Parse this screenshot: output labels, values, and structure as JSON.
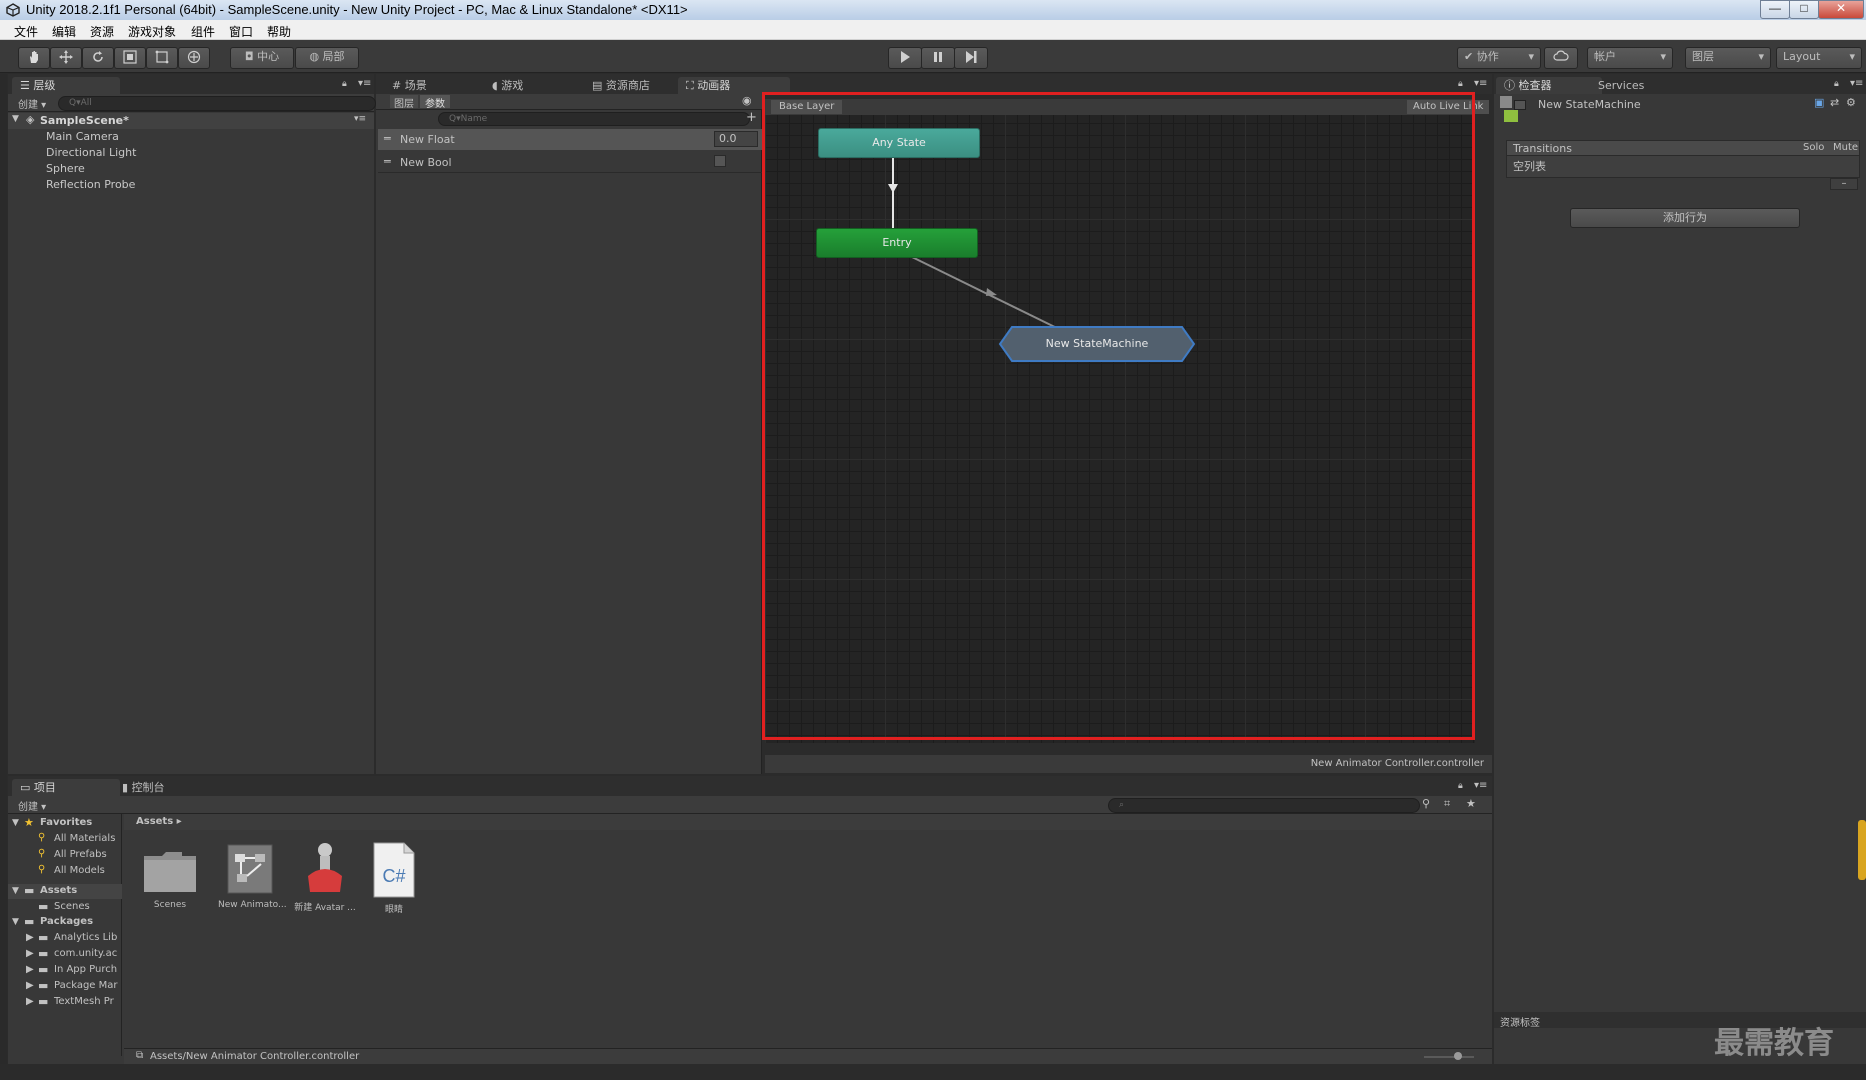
{
  "window": {
    "title": "Unity 2018.2.1f1 Personal (64bit) - SampleScene.unity - New Unity Project - PC, Mac & Linux Standalone* <DX11>",
    "min": "—",
    "max": "□",
    "close": "✕"
  },
  "menu": [
    "文件",
    "编辑",
    "资源",
    "游戏对象",
    "组件",
    "窗口",
    "帮助"
  ],
  "toolbar": {
    "pivot": "中心",
    "space": "局部",
    "collab": "协作",
    "account": "帐户",
    "layers": "图层",
    "layout": "Layout"
  },
  "hierarchy": {
    "tab": "层级",
    "create": "创建",
    "search_placeholder": "Q▾All",
    "scene": "SampleScene*",
    "items": [
      "Main Camera",
      "Directional Light",
      "Sphere",
      "Reflection Probe"
    ]
  },
  "center_tabs": [
    "场景",
    "游戏",
    "资源商店",
    "动画器"
  ],
  "animator": {
    "layers_tab": "图层",
    "params_tab": "参数",
    "search_placeholder": "Q▾Name",
    "params": [
      {
        "name": "New Float",
        "value": "0.0"
      },
      {
        "name": "New Bool",
        "value": ""
      }
    ],
    "breadcrumb": "Base Layer",
    "auto_live": "Auto Live Link",
    "nodes": {
      "any_state": "Any State",
      "entry": "Entry",
      "state_machine": "New StateMachine"
    },
    "footer": "New Animator Controller.controller",
    "colors": {
      "highlight": "#e02020",
      "entry": "#1d8a2e",
      "any_state": "#3b9b8c"
    }
  },
  "inspector": {
    "tab": "检查器",
    "services_tab": "Services",
    "object": "New StateMachine",
    "transitions": "Transitions",
    "solo": "Solo",
    "mute": "Mute",
    "empty_list": "空列表",
    "add_behaviour": "添加行为",
    "asset_labels": "资源标签"
  },
  "project": {
    "tab": "项目",
    "console_tab": "控制台",
    "create": "创建",
    "favorites_label": "Favorites",
    "favorites": [
      "All Materials",
      "All Prefabs",
      "All Models"
    ],
    "assets_label": "Assets",
    "assets_children": [
      "Scenes"
    ],
    "packages_label": "Packages",
    "packages": [
      "Analytics Lib",
      "com.unity.ac",
      "In App Purch",
      "Package Mar",
      "TextMesh Pr"
    ],
    "breadcrumb": "Assets",
    "files": [
      {
        "name": "Scenes",
        "icon": "folder-icon"
      },
      {
        "name": "New Animato...",
        "icon": "animator-controller-icon"
      },
      {
        "name": "新建 Avatar ...",
        "icon": "avatar-mask-icon"
      },
      {
        "name": "眼睛",
        "icon": "csharp-script-icon",
        "badge": "C#"
      }
    ],
    "path": "Assets/New Animator Controller.controller"
  },
  "watermark": "最需教育"
}
